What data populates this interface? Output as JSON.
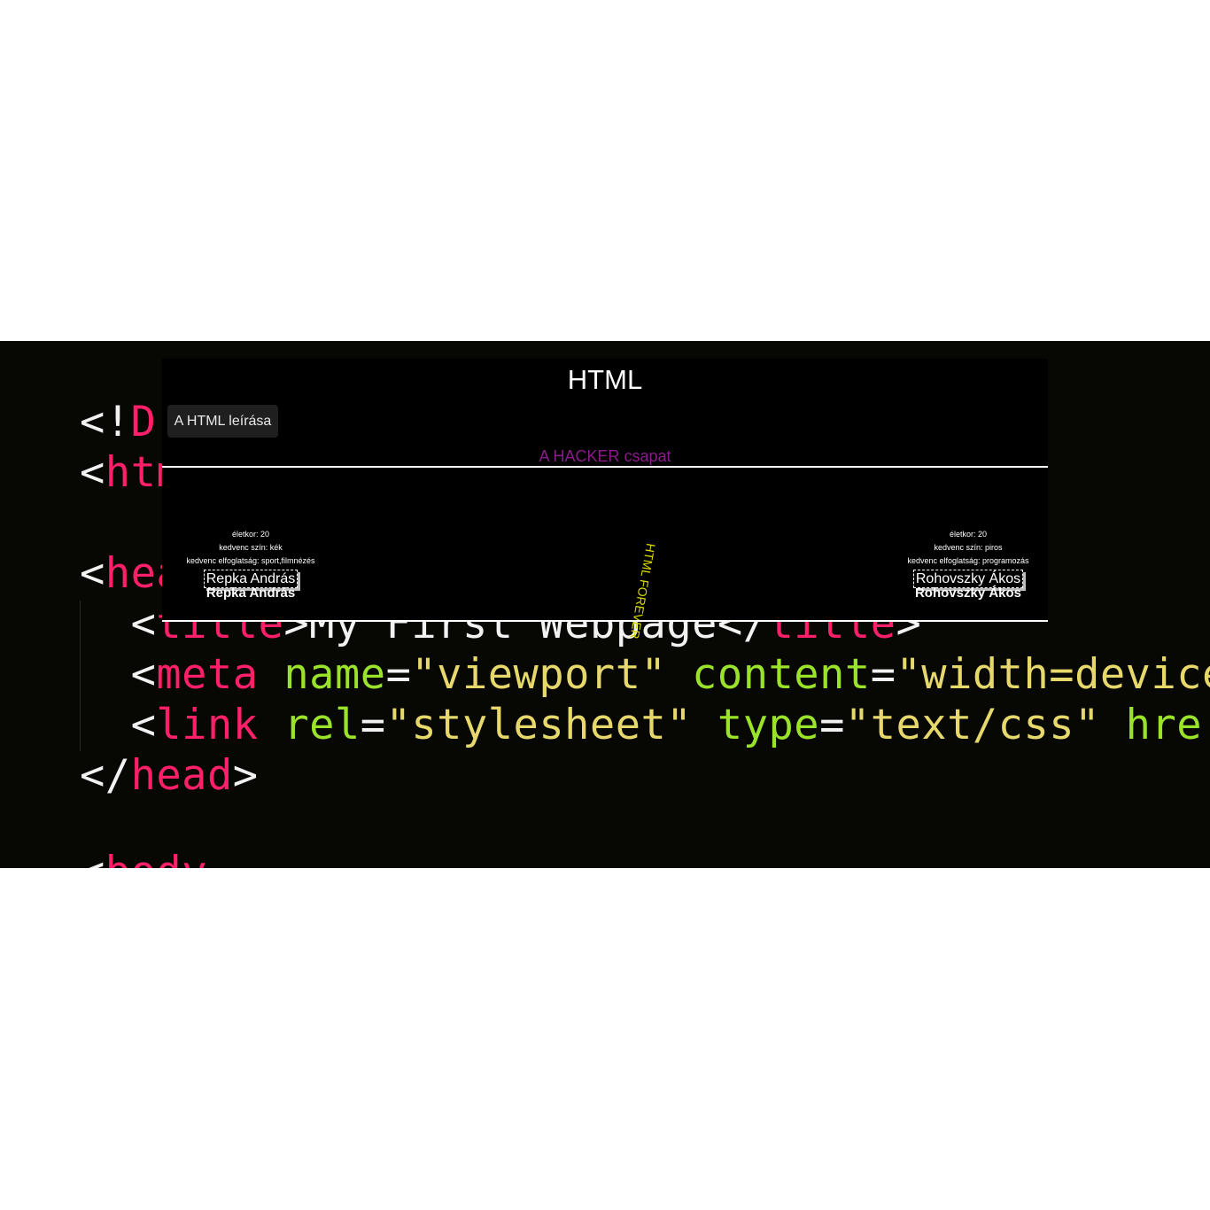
{
  "background_code": {
    "line1": [
      "<!",
      "D"
    ],
    "line2": [
      "<",
      "htm"
    ],
    "line3": [
      "<",
      "hea"
    ],
    "line4": [
      "  <",
      "title",
      ">My First Webpage</",
      "title",
      ">"
    ],
    "line5": [
      "  <",
      "meta",
      " ",
      "name",
      "=",
      "\"viewport\"",
      " ",
      "content",
      "=",
      "\"width=device"
    ],
    "line6": [
      "  <",
      "link",
      " ",
      "rel",
      "=",
      "\"stylesheet\"",
      " ",
      "type",
      "=",
      "\"text/css\"",
      " ",
      "hre"
    ],
    "line7": [
      "</",
      "head",
      ">"
    ],
    "line8": [
      "<",
      "body"
    ]
  },
  "page": {
    "title": "HTML",
    "description_button": "A HTML leírása",
    "team_title": "A HACKER csapat",
    "vertical_text": "HTML FOREVER"
  },
  "members": [
    {
      "age": "életkor: 20",
      "color": "kedvenc szín: kék",
      "hobby": "kedvenc elfoglatság: sport,filmnézés",
      "card_name": "Repka András",
      "name": "Repka András"
    },
    {
      "age": "életkor: 20",
      "color": "kedvenc szín: piros",
      "hobby": "kedvenc elfoglatság: programozás",
      "card_name": "Rohovszky Ákos",
      "name": "Rohovszky Ákos"
    }
  ],
  "colors": {
    "tag_pink": "#ff1f6a",
    "attr_green": "#9be32a",
    "string_yellow": "#e6d86b",
    "team_purple": "#8a1a8a",
    "forever_yellow": "#d8d800"
  }
}
